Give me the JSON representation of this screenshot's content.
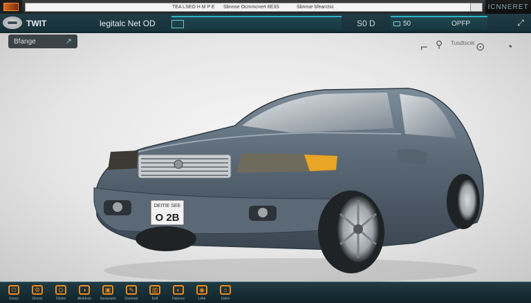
{
  "topbar": {
    "address_seg1": "TEA LSEO H M P E",
    "address_seg2": "Sbnnse Ocmmcnert 6E3S",
    "address_seg3": "Sbnnse bfearctsc",
    "right_text": "ICNNERET"
  },
  "header": {
    "app_name": "TWIT",
    "mode_title": "legitalc Net OD",
    "code_label": "S0 D",
    "right_tab_num": "50",
    "right_tab_label": "OPFP"
  },
  "viewport": {
    "range_button_label": "Bfange",
    "toolbar_label": "Tusdtscet",
    "plate_top": "DEITIE SEE",
    "plate_main": "O 2B"
  },
  "bottom_tools": [
    {
      "icon": "power-icon",
      "label": "Sosos"
    },
    {
      "icon": "tools-icon",
      "label": "Dinvos"
    },
    {
      "icon": "engine-icon",
      "label": "Oluino"
    },
    {
      "icon": "gauge-icon",
      "label": "Alleldvon"
    },
    {
      "icon": "battery-icon",
      "label": "Seoaciutel"
    },
    {
      "icon": "wrench-icon",
      "label": "Daromet"
    },
    {
      "icon": "chart-icon",
      "label": "Ealf"
    },
    {
      "icon": "dashboard-icon",
      "label": "Dainvos"
    },
    {
      "icon": "camera-icon",
      "label": "Lebe"
    },
    {
      "icon": "car-icon",
      "label": "Ualsn"
    }
  ],
  "colors": {
    "accent": "#f08a1a",
    "header_bg": "#1b3740",
    "highlight": "#2fb4c4",
    "car_body": "#5d6c7a"
  }
}
